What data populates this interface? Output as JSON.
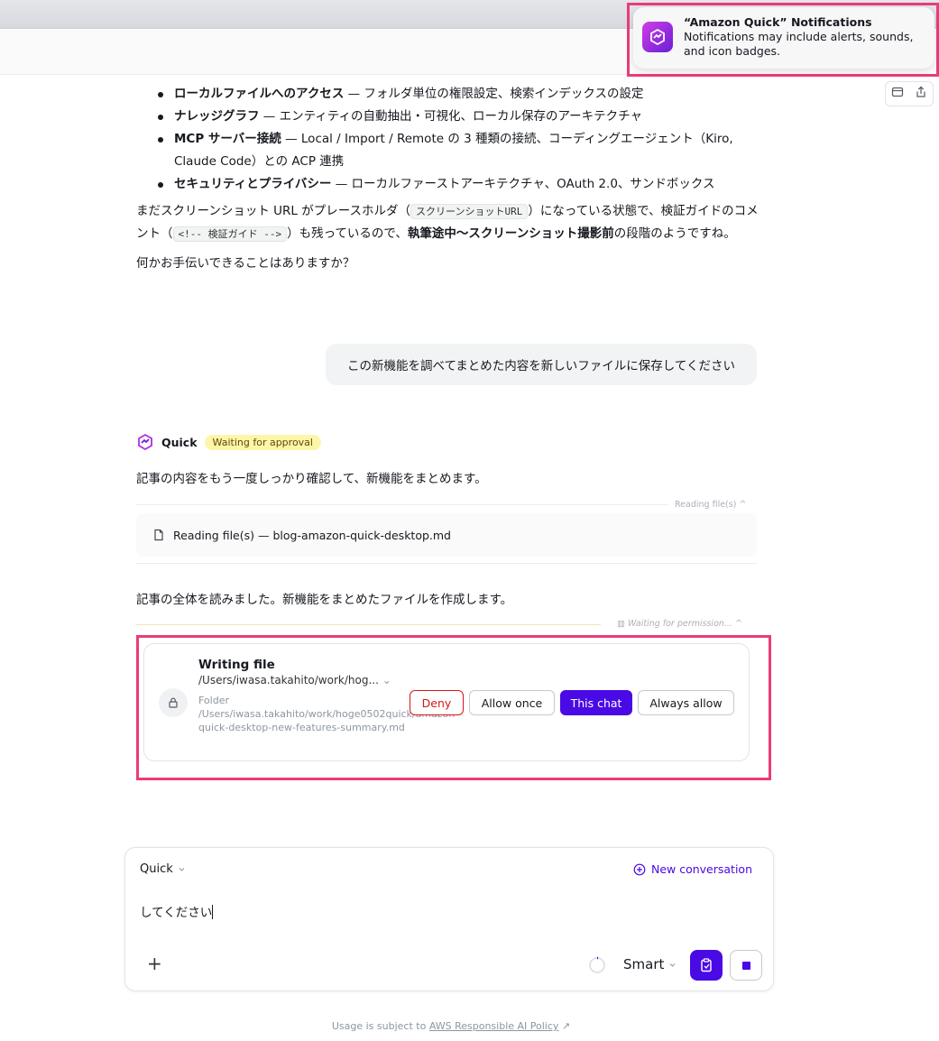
{
  "notification": {
    "title": "“Amazon Quick” Notifications",
    "body": "Notifications may include alerts, sounds, and icon badges."
  },
  "article": {
    "bullets": [
      {
        "bold": "ローカルファイルへのアクセス",
        "rest": " — フォルダ単位の権限設定、検索インデックスの設定"
      },
      {
        "bold": "ナレッジグラフ",
        "rest": " — エンティティの自動抽出・可視化、ローカル保存のアーキテクチャ"
      },
      {
        "bold": "MCP サーバー接続",
        "rest": " — Local / Import / Remote の 3 種類の接続、コーディングエージェント（Kiro, Claude Code）との ACP 連携"
      },
      {
        "bold": "セキュリティとプライバシー",
        "rest": " — ローカルファーストアーキテクチャ、OAuth 2.0、サンドボックス"
      }
    ],
    "para1_a": "まだスクリーンショット URL がプレースホルダ（",
    "para1_code1": "スクリーンショットURL",
    "para1_b": "）になっている状態で、検証ガイドのコメント（",
    "para1_code2": "<!-- 検証ガイド -->",
    "para1_c": "）も残っているので、",
    "para1_bold": "執筆途中〜スクリーンショット撮影前",
    "para1_d": "の段階のようですね。",
    "para2": "何かお手伝いできることはありますか？"
  },
  "user_message": "この新機能を調べてまとめた内容を新しいファイルに保存してください",
  "agent": {
    "name": "Quick",
    "status_badge": "Waiting for approval",
    "line1": "記事の内容をもう一度しっかり確認して、新機能をまとめます。",
    "reading_meta": "Reading file(s)",
    "reading_card": "Reading file(s) — blog-amazon-quick-desktop.md",
    "line2": "記事の全体を読みました。新機能をまとめたファイルを作成します。",
    "permission_meta": "Waiting for permission..."
  },
  "permission": {
    "title": "Writing file",
    "path": "/Users/iwasa.takahito/work/hog...",
    "folder_label": "Folder",
    "folder_path": "/Users/iwasa.takahito/work/hoge0502quick/amazon-quick-desktop-new-features-summary.md",
    "deny": "Deny",
    "allow_once": "Allow once",
    "this_chat": "This chat",
    "always_allow": "Always allow"
  },
  "composer": {
    "model": "Quick",
    "new_conversation": "New conversation",
    "text": "してください",
    "mode": "Smart"
  },
  "footer": {
    "prefix": "Usage is subject to ",
    "link": "AWS Responsible AI Policy"
  },
  "colors": {
    "accent": "#4a0ae5",
    "deny": "#d91515",
    "highlight_frame": "#ea3b7a",
    "badge_bg": "#fdf6a9"
  }
}
